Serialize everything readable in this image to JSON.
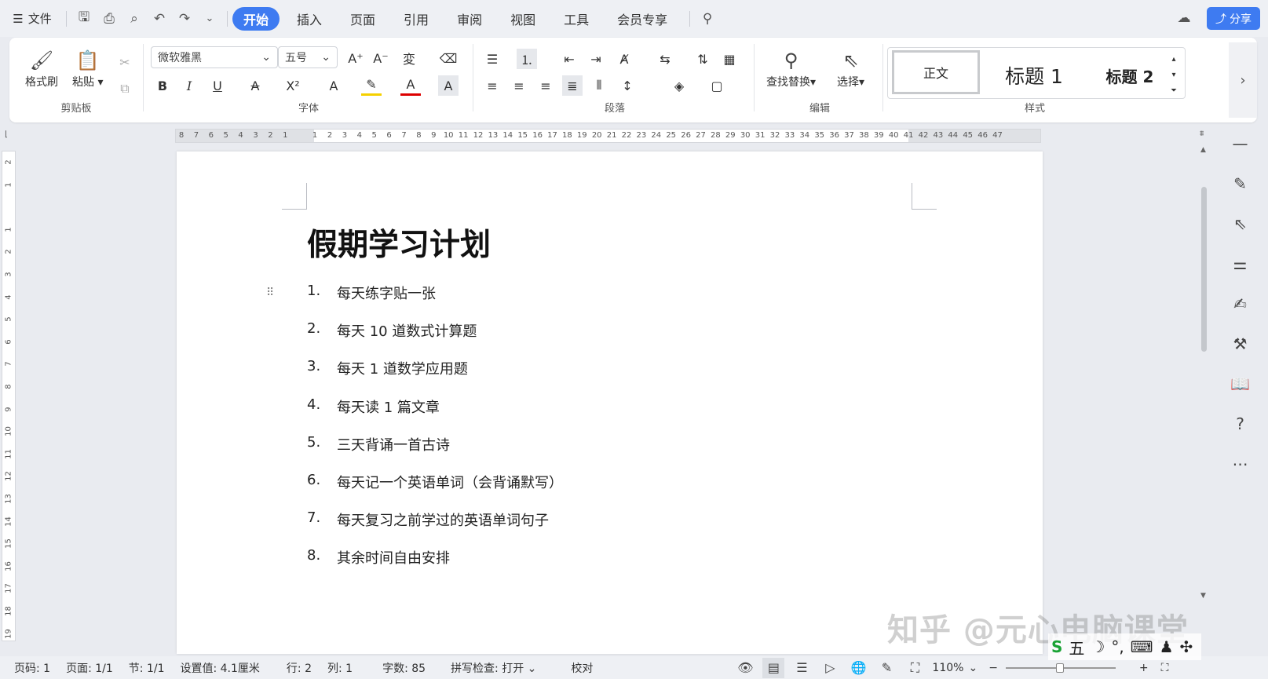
{
  "menubar": {
    "file": "文件",
    "tabs": [
      "开始",
      "插入",
      "页面",
      "引用",
      "审阅",
      "视图",
      "工具",
      "会员专享"
    ],
    "share": "分享"
  },
  "ribbon": {
    "clipboard": {
      "format_painter": "格式刷",
      "paste": "粘贴",
      "label": "剪贴板"
    },
    "font": {
      "font_name": "微软雅黑",
      "font_size": "五号",
      "label": "字体"
    },
    "paragraph": {
      "label": "段落"
    },
    "edit": {
      "find_replace": "查找替换",
      "select": "选择",
      "label": "编辑"
    },
    "styles": {
      "normal": "正文",
      "h1": "标题 1",
      "h2": "标题 2",
      "label": "样式"
    }
  },
  "ruler_marks": [
    "8",
    "7",
    "6",
    "5",
    "4",
    "3",
    "2",
    "1",
    "",
    "1",
    "2",
    "3",
    "4",
    "5",
    "6",
    "7",
    "8",
    "9",
    "10",
    "11",
    "12",
    "13",
    "14",
    "15",
    "16",
    "17",
    "18",
    "19",
    "20",
    "21",
    "22",
    "23",
    "24",
    "25",
    "26",
    "27",
    "28",
    "29",
    "30",
    "31",
    "32",
    "33",
    "34",
    "35",
    "36",
    "37",
    "38",
    "39",
    "40",
    "41",
    "42",
    "43",
    "44",
    "45",
    "46",
    "47"
  ],
  "vruler_marks": [
    "2",
    "1",
    "",
    "1",
    "2",
    "3",
    "4",
    "5",
    "6",
    "7",
    "8",
    "9",
    "10",
    "11",
    "12",
    "13",
    "14",
    "15",
    "16",
    "17",
    "18",
    "19"
  ],
  "document": {
    "title": "假期学习计划",
    "items": [
      {
        "num": "1.",
        "text": "每天练字贴一张"
      },
      {
        "num": "2.",
        "text": "每天 10 道数式计算题"
      },
      {
        "num": "3.",
        "text": "每天 1 道数学应用题"
      },
      {
        "num": "4.",
        "text": "每天读 1 篇文章"
      },
      {
        "num": "5.",
        "text": "三天背诵一首古诗"
      },
      {
        "num": "6.",
        "text": "每天记一个英语单词（会背诵默写）"
      },
      {
        "num": "7.",
        "text": "每天复习之前学过的英语单词句子"
      },
      {
        "num": "8.",
        "text": "其余时间自由安排"
      }
    ]
  },
  "statusbar": {
    "page_code": "页码: 1",
    "page": "页面: 1/1",
    "section": "节: 1/1",
    "setting": "设置值: 4.1厘米",
    "row": "行: 2",
    "col": "列: 1",
    "words": "字数: 85",
    "spell": "拼写检查: 打开",
    "proof": "校对",
    "zoom": "110%"
  },
  "watermark": "知乎 @元心电脑课堂",
  "ime": {
    "label": "五"
  },
  "colors": {
    "accent": "#3e7bf1",
    "page": "#ffffff",
    "background": "#e9ebf0"
  }
}
